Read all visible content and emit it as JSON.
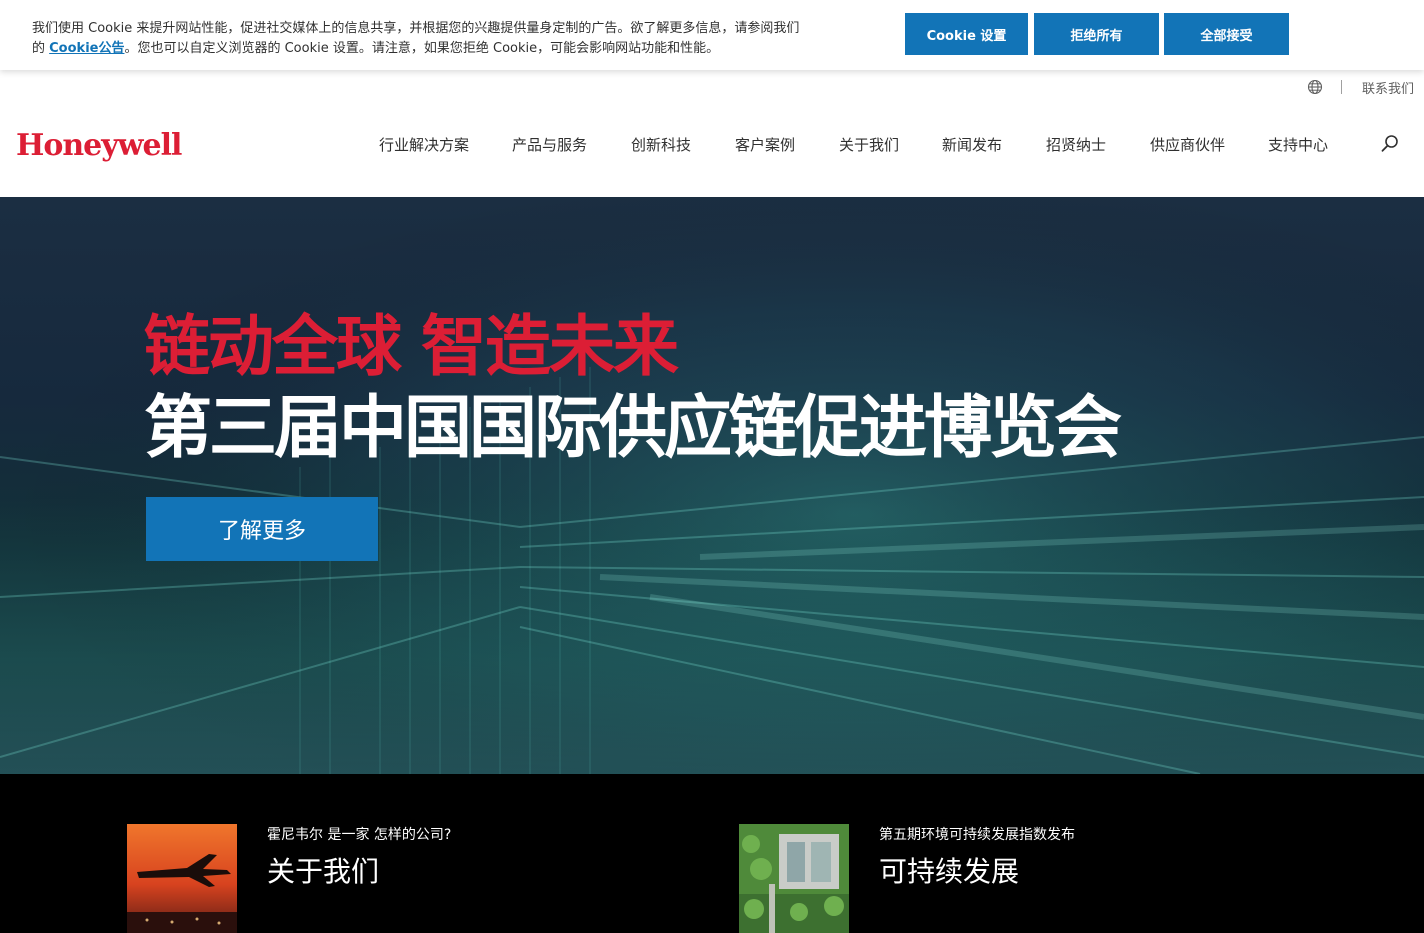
{
  "cookie": {
    "text_part1": "我们使用 Cookie 来提升网站性能，促进社交媒体上的信息共享，并根据您的兴趣提供量身定制的广告。欲了解更多信息，请参阅我们的 ",
    "link": "Cookie公告",
    "text_part2": "。您也可以自定义浏览器的 Cookie 设置。请注意，如果您拒绝 Cookie，可能会影响网站功能和性能。",
    "settings_label": "Cookie 设置",
    "reject_label": "拒绝所有",
    "accept_label": "全部接受"
  },
  "utility": {
    "contact": "联系我们"
  },
  "header": {
    "logo": "Honeywell",
    "nav": [
      "行业解决方案",
      "产品与服务",
      "创新科技",
      "客户案例",
      "关于我们",
      "新闻发布",
      "招贤纳士",
      "供应商伙伴",
      "支持中心"
    ]
  },
  "hero": {
    "title_red": "链动全球 智造未来",
    "title_white": "第三届中国国际供应链促进博览会",
    "cta": "了解更多"
  },
  "cards": [
    {
      "subtitle": "霍尼韦尔 是一家 怎样的公司?",
      "title": "关于我们"
    },
    {
      "subtitle": "第五期环境可持续发展指数发布",
      "title": "可持续发展"
    }
  ],
  "colors": {
    "brand_red": "#dc1e35",
    "accent_blue": "#1274b7"
  }
}
